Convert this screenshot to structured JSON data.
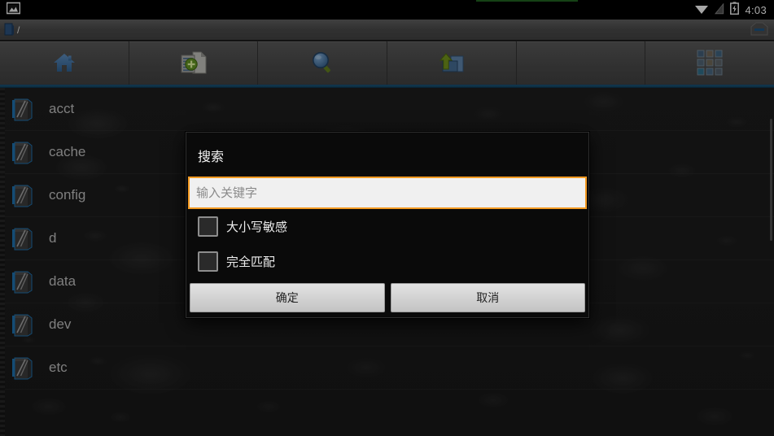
{
  "statusbar": {
    "notification_icon": "screenshot-image-icon",
    "wifi_icon": "wifi-icon",
    "signal_icon": "signal-bars-icon",
    "battery_icon": "battery-charging-icon",
    "clock": "4:03"
  },
  "pathbar": {
    "folder_icon": "folder-icon",
    "path": "/",
    "right_icon": "tab-indicator-icon"
  },
  "toolbar": {
    "buttons": [
      {
        "name": "home-button",
        "icon": "home-icon"
      },
      {
        "name": "new-file-button",
        "icon": "new-document-icon"
      },
      {
        "name": "search-button",
        "icon": "search-icon"
      },
      {
        "name": "parent-directory-button",
        "icon": "up-folder-icon"
      },
      {
        "name": "empty-slot",
        "icon": "none"
      },
      {
        "name": "apps-grid-button",
        "icon": "grid-apps-icon"
      }
    ]
  },
  "filelist": {
    "items": [
      {
        "name": "acct",
        "icon": "folder-icon"
      },
      {
        "name": "cache",
        "icon": "folder-icon"
      },
      {
        "name": "config",
        "icon": "folder-icon"
      },
      {
        "name": "d",
        "icon": "folder-icon"
      },
      {
        "name": "data",
        "icon": "folder-icon"
      },
      {
        "name": "dev",
        "icon": "folder-icon"
      },
      {
        "name": "etc",
        "icon": "folder-icon"
      }
    ]
  },
  "dialog": {
    "title": "搜索",
    "input_value": "",
    "input_placeholder": "输入关键字",
    "checkbox_case_sensitive": "大小写敏感",
    "checkbox_exact_match": "完全匹配",
    "ok_button": "确定",
    "cancel_button": "取消"
  },
  "colors": {
    "accent_focus": "#f39a22",
    "toolbar_underline": "#17506f",
    "dialog_bg": "#0a0a0a",
    "list_text": "#b7b7b7"
  }
}
